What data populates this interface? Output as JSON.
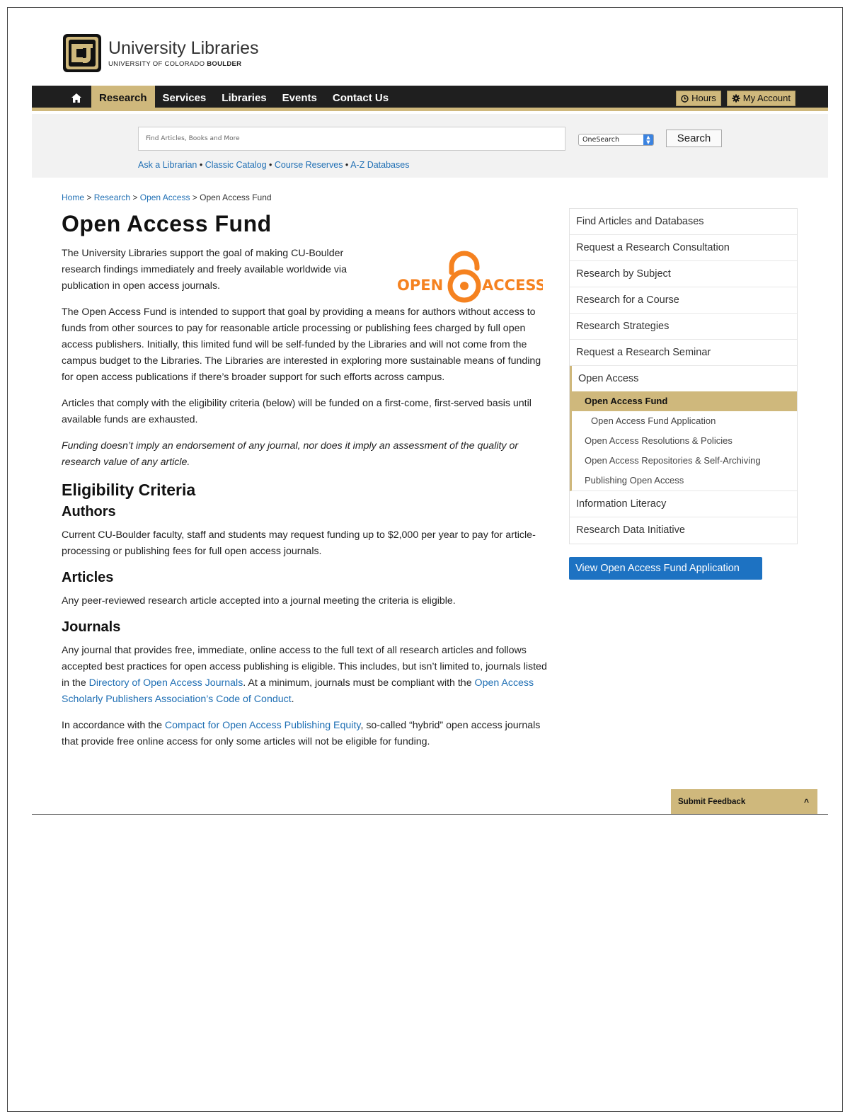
{
  "header": {
    "brand_title": "University Libraries",
    "brand_sub_prefix": "UNIVERSITY OF COLORADO ",
    "brand_sub_bold": "BOULDER",
    "logo_text": "CU"
  },
  "nav": {
    "home_icon": "home-icon",
    "items": [
      "Research",
      "Services",
      "Libraries",
      "Events",
      "Contact Us"
    ],
    "hours_label": "Hours",
    "account_label": "My Account"
  },
  "search": {
    "placeholder": "Find Articles, Books and More",
    "scope": "OneSearch",
    "button_label": "Search",
    "quick_links": [
      "Ask a Librarian",
      "Classic Catalog",
      "Course Reserves",
      "A-Z Databases"
    ],
    "separator": " • "
  },
  "breadcrumb": {
    "items": [
      "Home",
      "Research",
      "Open Access"
    ],
    "current": "Open Access Fund",
    "separator": " > "
  },
  "main": {
    "title": "Open Access Fund",
    "logo_open": "OPEN",
    "logo_access": "ACCESS",
    "p1": "The University Libraries support the goal of making CU-Boulder research findings immediately and freely available worldwide via publication in open access journals.",
    "p2": "The Open Access Fund is intended to support that goal by providing a means for authors without access to funds from other sources to pay for reasonable article processing or publishing fees charged by full open access publishers. Initially, this limited fund will be self-funded by the Libraries and will not come from the campus budget to the Libraries. The Libraries are interested in exploring more sustainable means of funding for open access publications if there’s broader support for such efforts across campus.",
    "p3": "Articles that comply with the eligibility criteria (below) will be funded on a first-come, first-served basis until available funds are exhausted.",
    "p4": "Funding doesn’t imply an endorsement of any journal, nor does it imply an assessment of the quality or research value of any article.",
    "eligibility_title": "Eligibility Criteria",
    "authors_title": "Authors",
    "authors_text": "Current CU-Boulder faculty, staff and students may request funding up to $2,000 per year to pay for article-processing or publishing fees for full open access journals.",
    "articles_title": "Articles",
    "articles_text": "Any peer-reviewed research article accepted into a journal meeting the criteria is eligible.",
    "journals_title": "Journals",
    "journals_text_1": "Any journal that provides free, immediate, online access to the full text of all research articles and follows accepted best practices for open access publishing is eligible. This includes, but isn’t limited to, journals listed in the ",
    "journals_link_1": "Directory of Open Access Journals",
    "journals_text_2": ". At a minimum, journals must be compliant with the ",
    "journals_link_2": "Open Access Scholarly Publishers Association’s Code of Conduct",
    "journals_text_3": ".",
    "compact_text_1": "In accordance with the ",
    "compact_link": "Compact for Open Access Publishing Equity",
    "compact_text_2": ", so-called “hybrid” open access journals that provide free online access for only some articles will not be eligible for funding."
  },
  "sidebar": {
    "items_top": [
      "Find Articles and Databases",
      "Request a Research Consultation",
      "Research by Subject",
      "Research for a Course",
      "Research Strategies",
      "Request a Research Seminar"
    ],
    "group_head": "Open Access",
    "group_active": "Open Access Fund",
    "group_deeper": "Open Access Fund Application",
    "group_subs": [
      "Open Access Resolutions & Policies",
      "Open Access Repositories & Self-Archiving",
      "Publishing Open Access"
    ],
    "items_bottom": [
      "Information Literacy",
      "Research Data Initiative"
    ],
    "apply_button": "View Open Access Fund Application"
  },
  "feedback": {
    "label": "Submit Feedback",
    "caret": "^"
  },
  "colors": {
    "gold": "#cfb87c",
    "nav_dark": "#1f1f1f",
    "link": "#1f6fb4",
    "button_blue": "#1d72c2",
    "oa_orange": "#f58220"
  }
}
